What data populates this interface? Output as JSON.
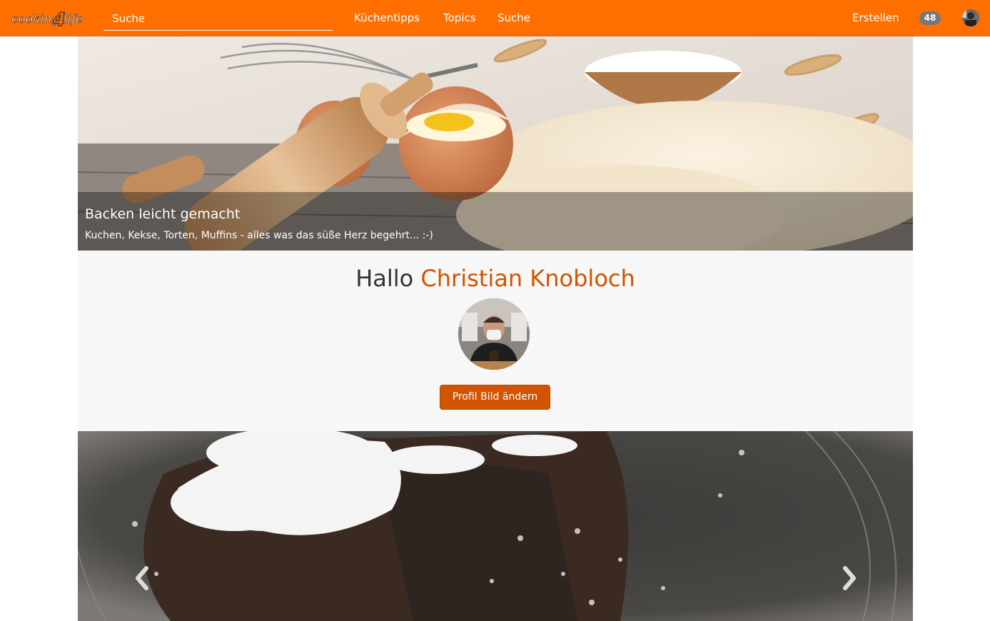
{
  "navbar": {
    "brand": "cooking4life",
    "search_placeholder": "Suche",
    "links": [
      "Küchentipps",
      "Topics",
      "Suche"
    ],
    "create_label": "Erstellen",
    "notification_count": "48",
    "accent_color": "#ff6f00"
  },
  "hero": {
    "title": "Backen leicht gemacht",
    "subtitle": "Kuchen, Kekse, Torten, Muffins - alles was das süße Herz begehrt... :-)"
  },
  "profile": {
    "greeting": "Hallo",
    "user_name": "Christian Knobloch",
    "change_picture_label": "Profil Bild ändern",
    "name_color": "#d35400"
  },
  "carousel": {
    "prev_icon": "chevron-left-icon",
    "next_icon": "chevron-right-icon"
  }
}
